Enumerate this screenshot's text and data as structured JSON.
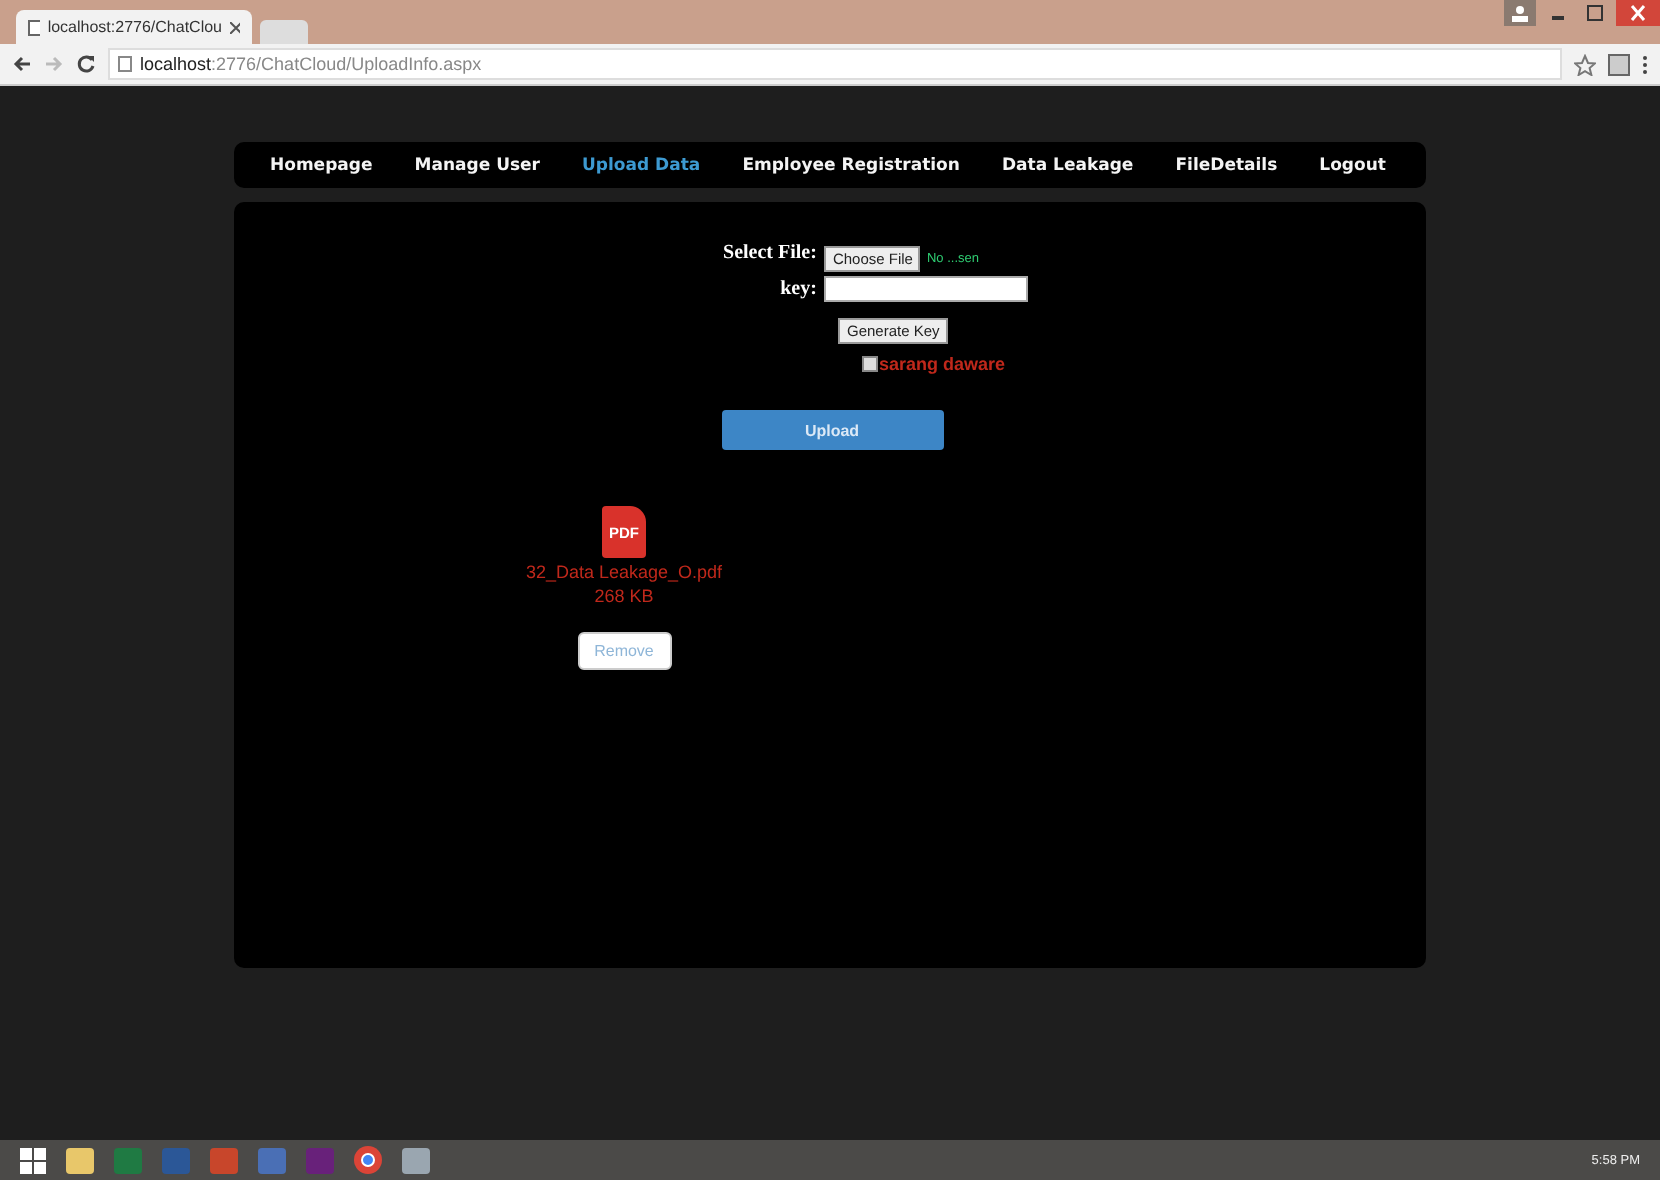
{
  "browser": {
    "tab_title": "localhost:2776/ChatClou",
    "address_host": "localhost",
    "address_path": ":2776/ChatCloud/UploadInfo.aspx"
  },
  "nav": [
    {
      "label": "Homepage",
      "selected": false
    },
    {
      "label": "Manage User",
      "selected": false
    },
    {
      "label": "Upload Data",
      "selected": true
    },
    {
      "label": "Employee Registration",
      "selected": false
    },
    {
      "label": "Data Leakage",
      "selected": false
    },
    {
      "label": "FileDetails",
      "selected": false
    },
    {
      "label": "Logout",
      "selected": false
    }
  ],
  "form": {
    "file_label": "Select File:",
    "choose_button": "Choose File",
    "file_status": "No ...sen",
    "key_label": "key:",
    "generate_button": "Generate Key",
    "checkbox": {
      "label": "sarang daware",
      "checked": false
    },
    "upload_button": "Upload"
  },
  "file": {
    "badge": "PDF",
    "name": "32_Data Leakage_O.pdf",
    "size": "268 KB",
    "remove_button": "Remove"
  },
  "taskbar": {
    "time": "5:58 PM"
  }
}
